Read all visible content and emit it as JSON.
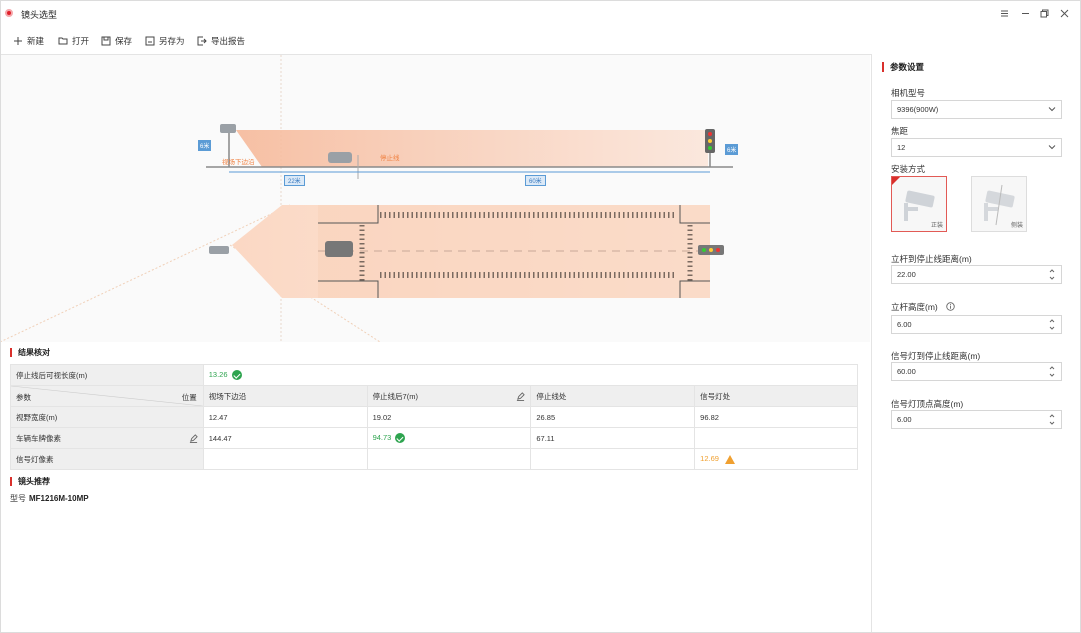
{
  "window": {
    "title": "镜头选型"
  },
  "toolbar": {
    "new_label": "新建",
    "open_label": "打开",
    "save_label": "保存",
    "save_as_label": "另存为",
    "export_label": "导出报告"
  },
  "diagram": {
    "pole_height_tag": "6米",
    "signal_height_tag": "6米",
    "near_label": "视场下边沿",
    "stop_label": "停止线",
    "dist_left_tag": "22米",
    "dist_right_tag": "60米"
  },
  "results": {
    "title": "结果核对",
    "visible_length_label": "停止线后可视长度(m)",
    "visible_length_value": "13.26",
    "header_param": "参数",
    "header_position": "位置",
    "columns": [
      "视场下边沿",
      "停止线后7(m)",
      "停止线处",
      "信号灯处"
    ],
    "rows": [
      {
        "label": "视野宽度(m)",
        "values": [
          "12.47",
          "19.02",
          "26.85",
          "96.82"
        ]
      },
      {
        "label": "车辆车牌像素",
        "values": [
          "144.47",
          "94.73",
          "67.11",
          ""
        ]
      },
      {
        "label": "信号灯像素",
        "values": [
          "",
          "",
          "",
          "12.69"
        ]
      }
    ]
  },
  "lens": {
    "title": "镜头推荐",
    "model_label": "型号",
    "model_value": "MF1216M-10MP"
  },
  "params": {
    "title": "参数设置",
    "camera_model_label": "相机型号",
    "camera_model_value": "9396(900W)",
    "focal_label": "焦距",
    "focal_value": "12",
    "mount_label": "安装方式",
    "mount_front": "正装",
    "mount_side": "侧装",
    "pole_to_stop_label": "立杆到停止线距离(m)",
    "pole_to_stop_value": "22.00",
    "pole_height_label": "立杆高度(m)",
    "pole_height_value": "6.00",
    "signal_to_stop_label": "信号灯到停止线距离(m)",
    "signal_to_stop_value": "60.00",
    "signal_height_label": "信号灯顶点高度(m)",
    "signal_height_value": "6.00"
  },
  "colors": {
    "accent_red": "#d9302c",
    "ok_green": "#2ea44f",
    "warn_orange": "#f0a030",
    "tag_blue": "#5b9bd5"
  }
}
